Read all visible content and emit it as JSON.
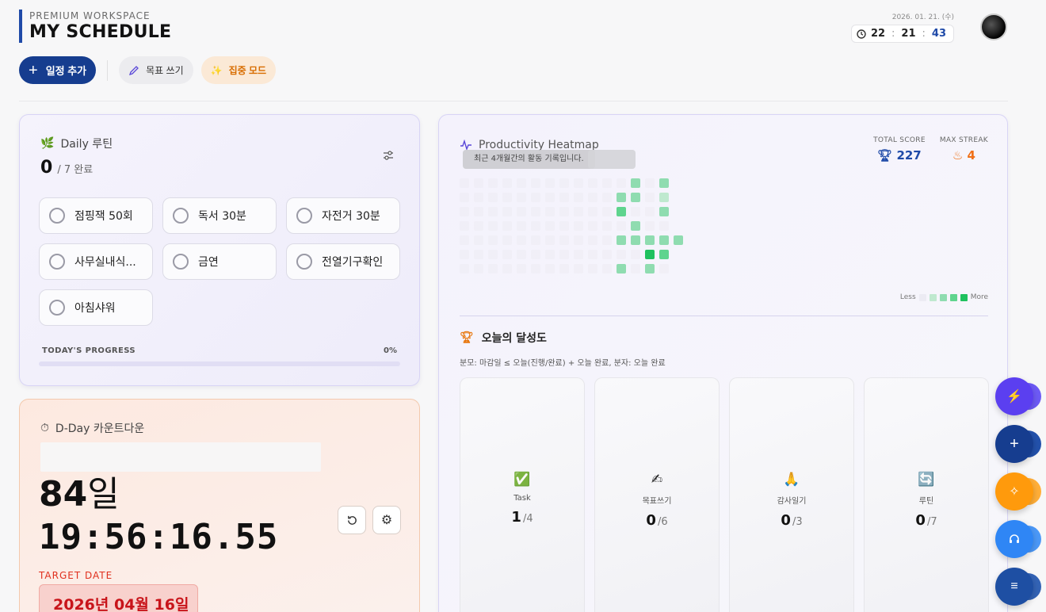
{
  "brand": {
    "subtitle": "PREMIUM WORKSPACE",
    "title": "MY SCHEDULE"
  },
  "clock": {
    "date": "2026. 01. 21. (수)",
    "hours": "22",
    "minutes": "21",
    "seconds": "43"
  },
  "toolbar": {
    "add_label": "일정 추가",
    "goal_label": "목표 쓰기",
    "focus_label": "집중 모드"
  },
  "routine": {
    "title": "Daily 루틴",
    "done_count": "0",
    "total_text": "/ 7 완료",
    "items": [
      {
        "label": "점핑잭 50회"
      },
      {
        "label": "독서 30분"
      },
      {
        "label": "자전거 30분"
      },
      {
        "label": "사무실내식..."
      },
      {
        "label": "금연"
      },
      {
        "label": "전열기구확인"
      },
      {
        "label": "아침샤워"
      }
    ],
    "progress_label": "TODAY'S PROGRESS",
    "progress_text": "0%",
    "progress_value": 0
  },
  "dday": {
    "title": "D-Day 카운트다운",
    "days_number": "84",
    "days_unit": "일",
    "time": "19:56:16.55",
    "target_label": "TARGET DATE",
    "target_date": "2026년 04월 16일"
  },
  "heatmap": {
    "title": "Productivity Heatmap",
    "tooltip": "최근 4개월간의 활동 기록입니다.",
    "total_score_label": "TOTAL SCORE",
    "total_score": "227",
    "max_streak_label": "MAX STREAK",
    "max_streak": "4",
    "legend_less": "Less",
    "legend_more": "More",
    "colors": {
      "empty": "#ecebf3",
      "l1": "#bfe9cf",
      "l2": "#8fdcb0",
      "l3": "#5fd48e",
      "l4": "#1fc15e"
    }
  },
  "achievement": {
    "title": "오늘의 달성도",
    "note": "분모: 마감일 ≤ 오늘(진행/완료) + 오늘 완료, 분자: 오늘 완료",
    "cards": [
      {
        "icon": "✅",
        "label": "Task",
        "done": "1",
        "total": "/4"
      },
      {
        "icon": "✍",
        "label": "목표쓰기",
        "done": "0",
        "total": "/6"
      },
      {
        "icon": "🙏",
        "label": "감사일기",
        "done": "0",
        "total": "/3"
      },
      {
        "icon": "🔄",
        "label": "루틴",
        "done": "0",
        "total": "/7"
      }
    ]
  },
  "fabs": {
    "colors": [
      "#5b3ff0",
      "#163d8f",
      "#ff9a0c",
      "#2f86f5",
      "#1e4fa3"
    ]
  }
}
